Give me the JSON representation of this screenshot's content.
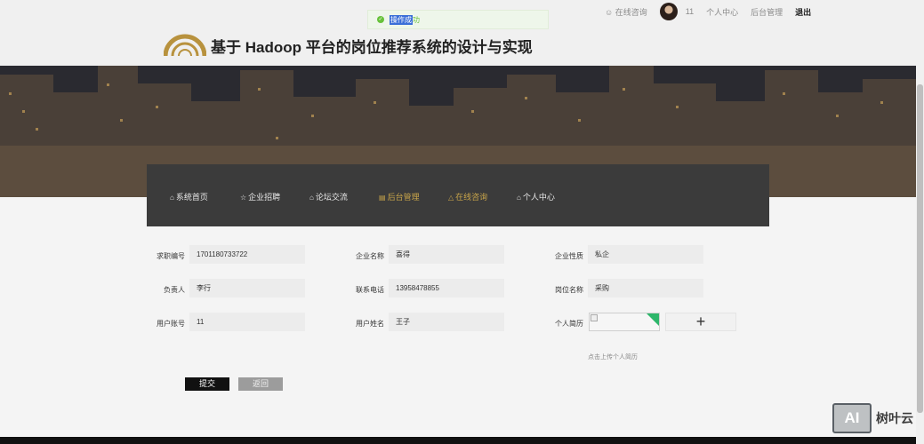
{
  "topbar": {
    "consult": "在线咨询",
    "username": "11",
    "profile": "个人中心",
    "admin": "后台管理",
    "logout": "退出"
  },
  "toast": {
    "message_selected": "操作成",
    "message_rest": "功"
  },
  "header": {
    "title": "基于 Hadoop 平台的岗位推荐系统的设计与实现"
  },
  "nav": {
    "items": [
      {
        "label": "系统首页",
        "icon": "home-icon"
      },
      {
        "label": "企业招聘",
        "icon": "star-icon"
      },
      {
        "label": "论坛交流",
        "icon": "forum-icon"
      },
      {
        "label": "后台管理",
        "icon": "admin-icon"
      },
      {
        "label": "在线咨询",
        "icon": "warning-icon"
      },
      {
        "label": "个人中心",
        "icon": "home-icon"
      }
    ]
  },
  "form": {
    "job_no_label": "求职编号",
    "job_no_value": "1701180733722",
    "company_label": "企业名称",
    "company_value": "喜得",
    "nature_label": "企业性质",
    "nature_value": "私企",
    "owner_label": "负责人",
    "owner_value": "李行",
    "phone_label": "联系电话",
    "phone_value": "13958478855",
    "position_label": "岗位名称",
    "position_value": "采购",
    "account_label": "用户账号",
    "account_value": "11",
    "name_label": "用户姓名",
    "name_value": "王子",
    "resume_label": "个人简历",
    "upload_hint": "点击上传个人简历",
    "upload_plus": "+"
  },
  "buttons": {
    "submit": "提交",
    "back": "返回"
  },
  "watermark": {
    "logo": "AI",
    "text": "树叶云"
  },
  "colors": {
    "nav_bg": "#3b3b3b",
    "accent_gold": "#c9a54a",
    "success": "#67c23a",
    "submit_bg": "#111111"
  }
}
